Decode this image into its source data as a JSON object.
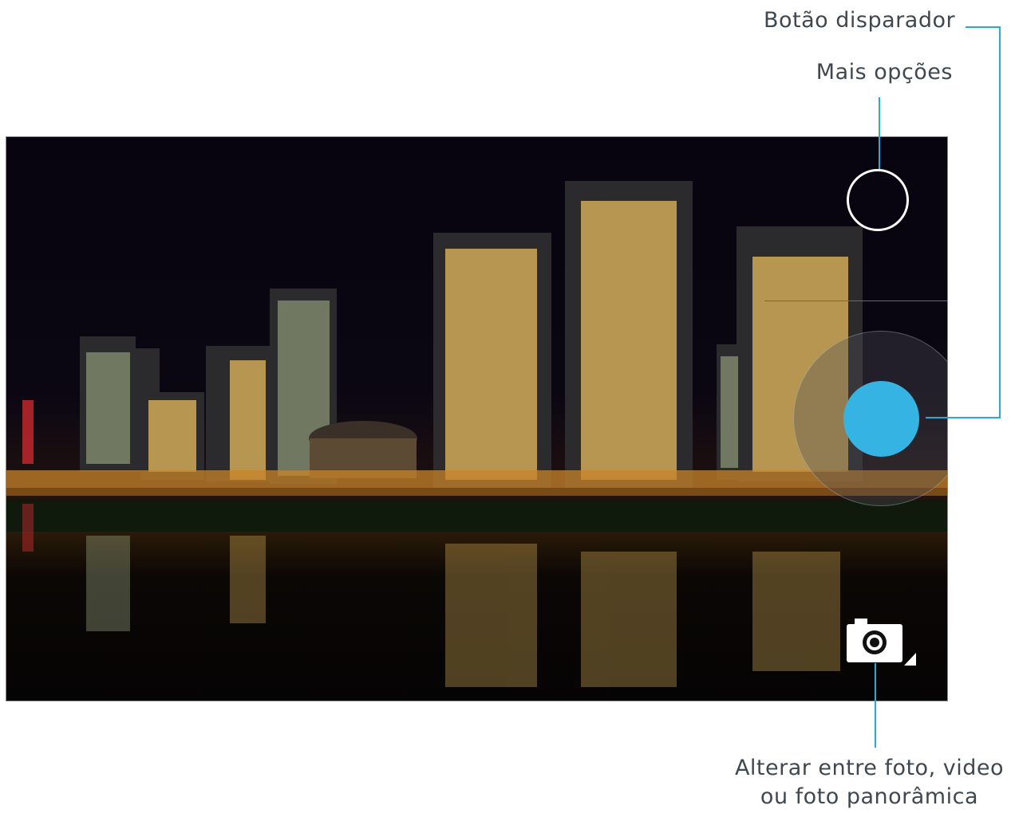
{
  "callouts": {
    "shutter_button": "Botão disparador",
    "more_options": "Mais opções",
    "switch_mode_line1": "Alterar entre foto, video",
    "switch_mode_line2": "ou foto panorâmica"
  },
  "colors": {
    "accent": "#2ba8d6",
    "shutter": "#35b4e3",
    "text": "#3f4850"
  },
  "icons": {
    "more_options": "circle-outline-icon",
    "shutter": "shutter-icon",
    "mode": "camera-icon"
  }
}
